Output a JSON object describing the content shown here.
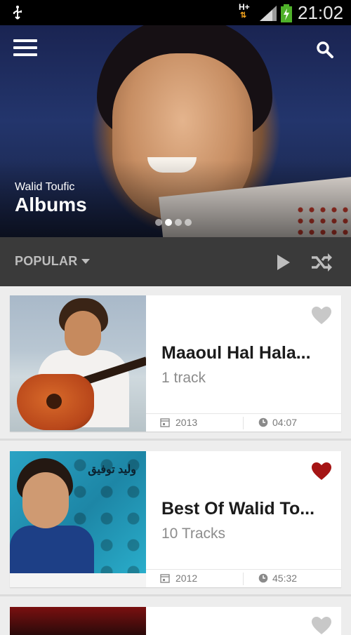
{
  "status_bar": {
    "network": "H+",
    "time": "21:02"
  },
  "header": {
    "artist": "Walid Toufic",
    "section": "Albums",
    "pager": {
      "count": 4,
      "active_index": 1
    }
  },
  "toolbar": {
    "sort_label": "POPULAR"
  },
  "albums": [
    {
      "title": "Maaoul Hal Hala...",
      "tracks": "1 track",
      "year": "2013",
      "duration": "04:07",
      "favorite": false
    },
    {
      "title": "Best Of Walid To...",
      "tracks": "10 Tracks",
      "year": "2012",
      "duration": "45:32",
      "favorite": true,
      "cover_text": "وليد توفيق"
    }
  ],
  "colors": {
    "accent": "#a51414",
    "heart_off": "#c8c8c8",
    "toolbar_bg": "#3a3a3a",
    "card_bg": "#ffffff"
  },
  "icons": [
    "usb-icon",
    "signal-icon",
    "battery-icon",
    "menu-icon",
    "search-icon",
    "chevron-down-icon",
    "play-icon",
    "shuffle-icon",
    "heart-icon",
    "calendar-icon",
    "clock-icon"
  ]
}
